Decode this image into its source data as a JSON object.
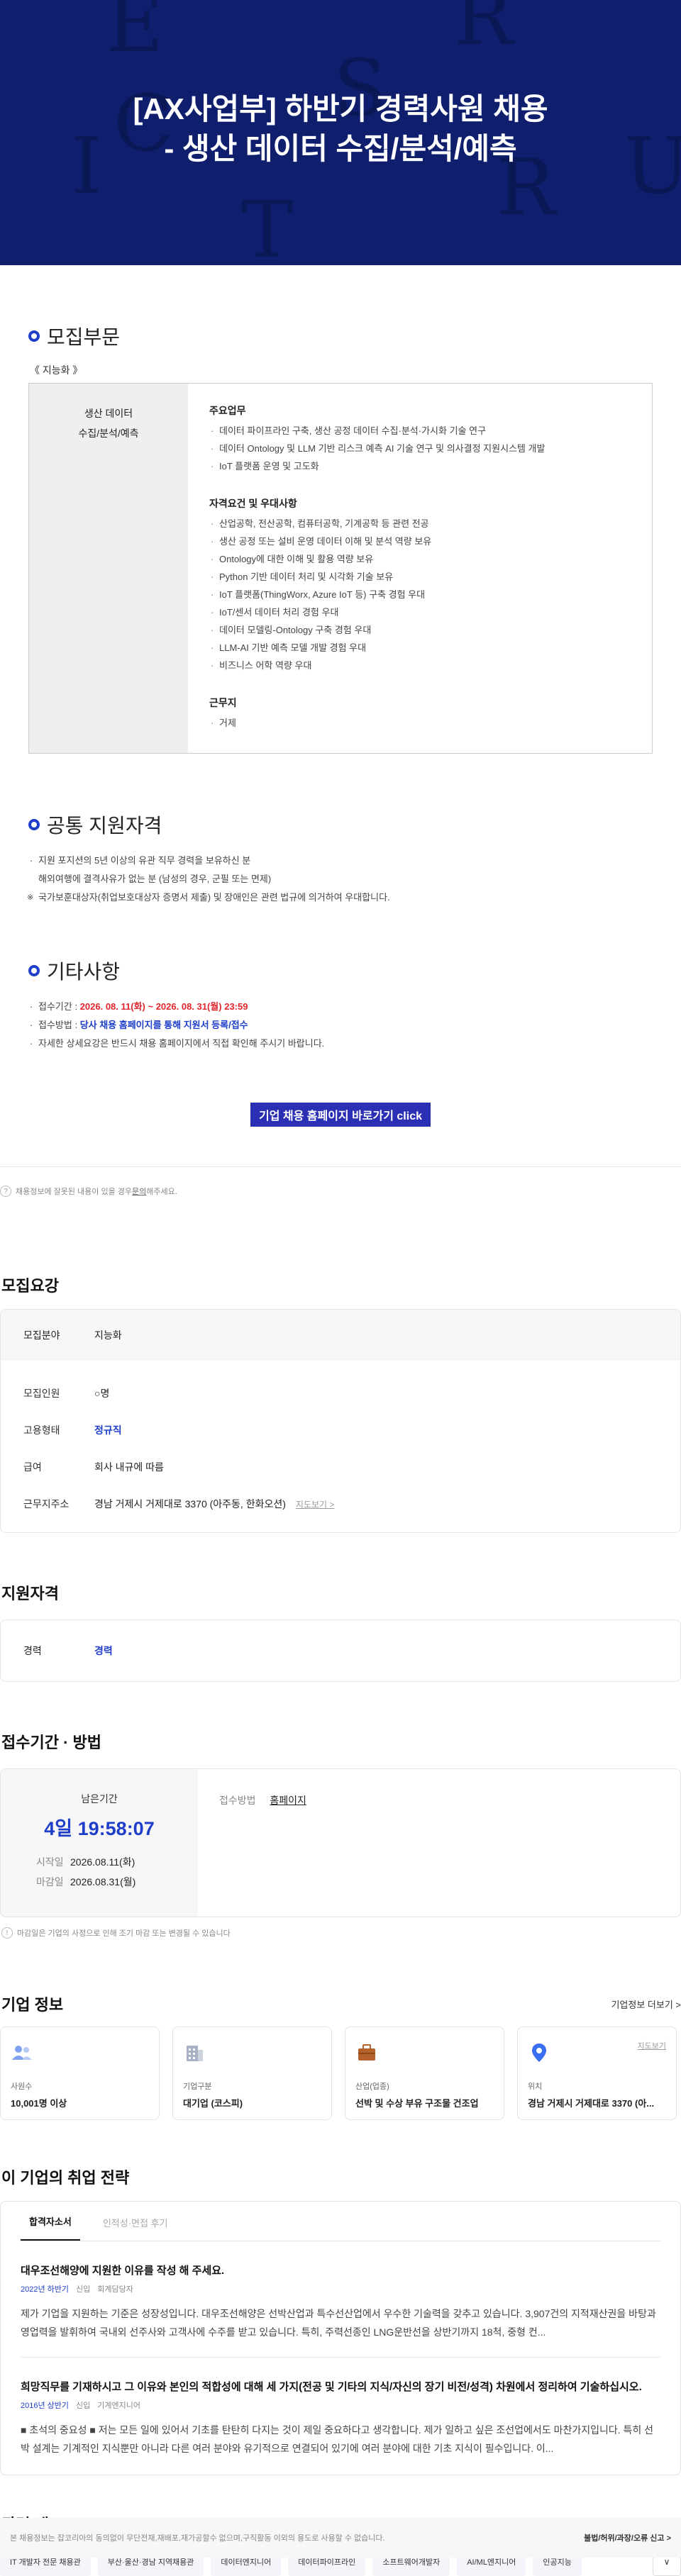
{
  "hero": {
    "title_line1": "[AX사업부] 하반기 경력사원 채용",
    "title_line2": "- 생산 데이터 수집/분석/예측",
    "deco_letters": [
      "E",
      "R",
      "S",
      "C",
      "I",
      "U",
      "T",
      "R"
    ]
  },
  "notice": {
    "recruit": {
      "heading": "모집부문",
      "sub_label": "《 지능화 》",
      "position_line1": "생산 데이터",
      "position_line2": "수집/분석/예측",
      "duties_title": "주요업무",
      "duties": [
        "데이터 파이프라인 구축, 생산 공정 데이터 수집·분석·가시화 기술 연구",
        "데이터 Ontology 및 LLM 기반 리스크 예측 AI 기술 연구 및 의사결정 지원시스템 개발",
        "IoT 플랫폼 운영 및 고도화"
      ],
      "quals_title": "자격요건 및 우대사항",
      "quals": [
        "산업공학, 전산공학, 컴퓨터공학, 기계공학 등 관련 전공",
        "생산 공정 또는 설비 운영 데이터 이해 및 분석 역량 보유",
        "Ontology에 대한 이해 및 활용 역량 보유",
        "Python 기반 데이터 처리 및 시각화 기술 보유",
        "IoT 플랫폼(ThingWorx, Azure IoT 등) 구축 경험 우대",
        "IoT/센서 데이터 처리 경험 우대",
        "데이터 모델링-Ontology 구축 경험 우대",
        "LLM-AI 기반 예측 모델 개발 경험 우대",
        "비즈니스 어학 역량 우대"
      ],
      "location_title": "근무지",
      "location": [
        "거제"
      ]
    },
    "common": {
      "heading": "공통 지원자격",
      "line1": "지원 포지션의 5년 이상의 유관 직무 경력을 보유하신 분",
      "line2": "해외여행에 결격사유가 없는 분 (남성의 경우, 군필 또는 면제)",
      "line3": "국가보훈대상자(취업보호대상자 증명서 제출) 및 장애인은 관련 법규에 의거하여 우대합니다."
    },
    "etc": {
      "heading": "기타사항",
      "period_label": "접수기간 : ",
      "period_value": "2026. 08. 11(화) ~ 2026. 08. 31(월) 23:59",
      "method_label": "접수방법 : ",
      "method_value": "당사 채용 홈페이지를 통해 지원서 등록/접수",
      "detail": "자세한 상세요강은 반드시 채용 홈페이지에서 직접 확인해 주시기 바랍니다."
    },
    "cta": "기업 채용 홈페이지 바로가기 click"
  },
  "report_note": {
    "text_before": "채용정보에 잘못된 내용이 있을 경우 ",
    "link": "문의",
    "text_after": "해주세요."
  },
  "recruit_summary": {
    "title": "모집요강",
    "field_label": "모집분야",
    "field_value": "지능화",
    "rows": [
      {
        "k": "모집인원",
        "v": "○명"
      },
      {
        "k": "고용형태",
        "v": "정규직"
      },
      {
        "k": "급여",
        "v": "회사 내규에 따름"
      },
      {
        "k": "근무지주소",
        "v": "경남 거제시 거제대로 3370 (아주동, 한화오션)"
      }
    ],
    "map_link": "지도보기 >"
  },
  "qualification": {
    "title": "지원자격",
    "k": "경력",
    "v": "경력"
  },
  "apply": {
    "title": "접수기간 · 방법",
    "remaining_label": "남은기간",
    "timer": "4일 19:58:07",
    "start_label": "시작일",
    "start": "2026.08.11(화)",
    "end_label": "마감일",
    "end": "2026.08.31(월)",
    "method_label": "접수방법",
    "method": "홈페이지",
    "note": "마감일은 기업의 사정으로 인해 조기 마감 또는 변경될 수 있습니다"
  },
  "company": {
    "title": "기업 정보",
    "more": "기업정보 더보기 >",
    "cards": [
      {
        "icon": "people-icon",
        "k": "사원수",
        "v": "10,001명 이상"
      },
      {
        "icon": "building-icon",
        "k": "기업구분",
        "v": "대기업 (코스피)"
      },
      {
        "icon": "briefcase-icon",
        "k": "산업(업종)",
        "v": "선박 및 수상 부유 구조물 건조업"
      },
      {
        "icon": "location-pin-icon",
        "k": "위치",
        "v": "경남 거제시 거제대로 3370 (아...",
        "map": "지도보기"
      }
    ]
  },
  "strategy": {
    "title": "이 기업의 취업 전략",
    "tabs": [
      "합격자소서",
      "인적성·면접 후기"
    ],
    "items": [
      {
        "q": "대우조선해양에 지원한 이유를 작성 해 주세요.",
        "year": "2022년 하반기",
        "type": "신입",
        "role": "회계담당자",
        "a": "제가 기업을 지원하는 기준은 성장성입니다. 대우조선해양은 선박산업과 특수선산업에서 우수한 기술력을 갖추고 있습니다. 3,907건의 지적재산권을 바탕과 영업력을 발휘하여 국내외 선주사와 고객사에 수주를 받고 있습니다. 특히, 주력선종인 LNG운반선을 상반기까지 18척, 중형 컨..."
      },
      {
        "q": "희망직무를 기재하시고 그 이유와 본인의 적합성에 대해 세 가지(전공 및 기타의 지식/자신의 장기 비전/성격) 차원에서 정리하여 기술하십시오.",
        "year": "2016년 상반기",
        "type": "신입",
        "role": "기계엔지니어",
        "a": "■ 초석의 중요성 ■ 저는 모든 일에 있어서 기초를 탄탄히 다지는 것이 제일 중요하다고 생각합니다. 제가 일하고 싶은 조선업에서도 마찬가지입니다. 특히 선박 설계는 기계적인 지식뿐만 아니라 다른 여러 분야와 유기적으로 연결되어 있기에 여러 분야에 대한 기초 지식이 필수입니다. 이..."
      }
    ]
  },
  "tags": {
    "title": "관련 태그",
    "items": [
      "IT 개발자 전문 채용관",
      "부산·울산·경남 지역채용관",
      "데이터엔지니어",
      "데이터파이프라인",
      "소프트웨어개발자",
      "AI/ML엔지니어",
      "인공지능"
    ],
    "more": "∨"
  },
  "footer": {
    "left": "본 채용정보는 잡코리아의 동의없이 무단전재,재배포,재가공할수 없으며,구직활동 이외의 용도로 사용할 수 없습니다.",
    "right": "불법/허위/과장/오류 신고 >"
  }
}
